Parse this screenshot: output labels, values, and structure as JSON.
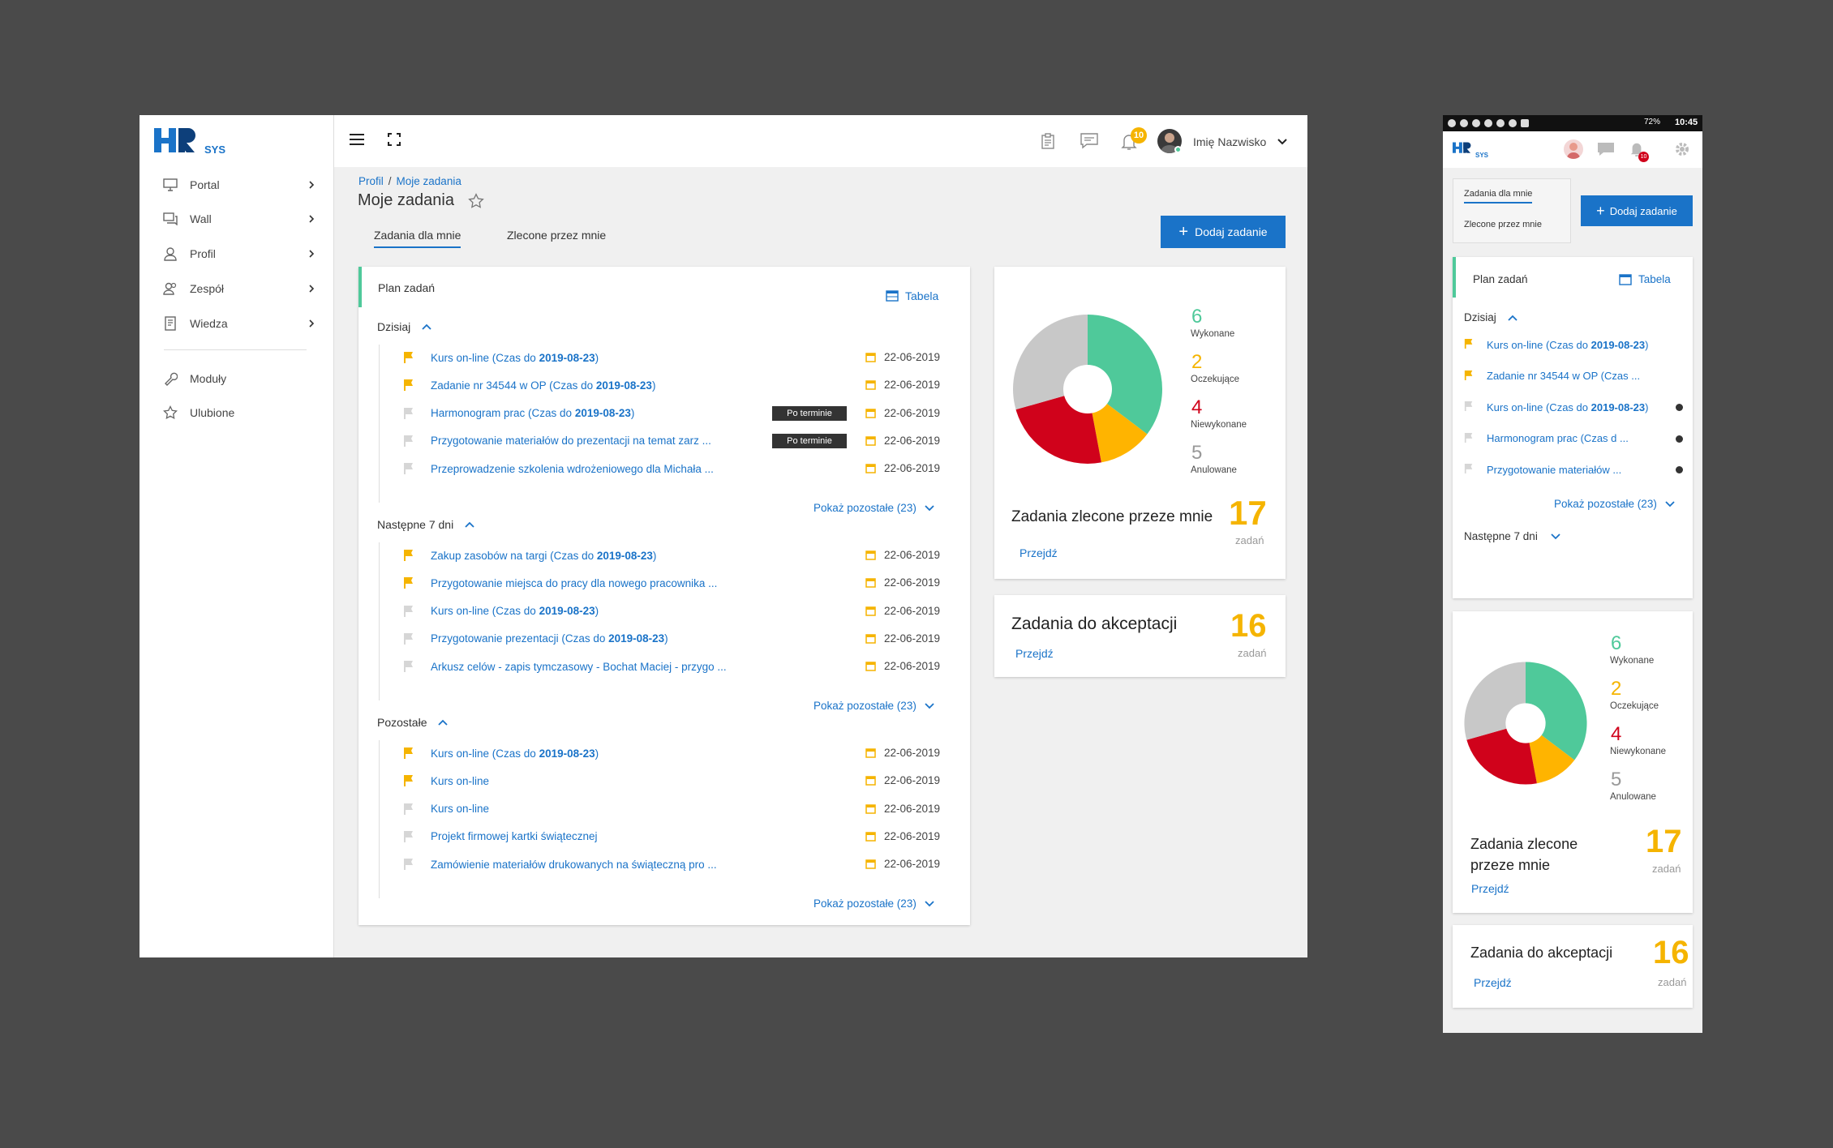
{
  "brand": {
    "logo": "HR",
    "logo_sub": "SYS"
  },
  "sidebar": {
    "items": [
      {
        "label": "Portal",
        "icon": "monitor-icon"
      },
      {
        "label": "Wall",
        "icon": "chat-icon"
      },
      {
        "label": "Profil",
        "icon": "user-icon"
      },
      {
        "label": "Zespół",
        "icon": "team-icon"
      },
      {
        "label": "Wiedza",
        "icon": "book-icon"
      }
    ],
    "extra": [
      {
        "label": "Moduły",
        "icon": "wrench-icon"
      },
      {
        "label": "Ulubione",
        "icon": "star-icon"
      }
    ]
  },
  "topbar": {
    "notif_count": "10",
    "user_name": "Imię Nazwisko"
  },
  "breadcrumb": [
    "Profil",
    "Moje zadania"
  ],
  "page_title": "Moje zadania",
  "tabs": [
    "Zadania dla mnie",
    "Zlecone przez mnie"
  ],
  "add_button": "Dodaj zadanie",
  "plan": {
    "title": "Plan zadań",
    "table_link": "Tabela",
    "sections": [
      {
        "label": "Dzisiaj",
        "tasks": [
          {
            "pre": "Kurs on-line (Czas do ",
            "bold": "2019-08-23",
            "post": ")",
            "flag": "yellow",
            "date": "22-06-2019",
            "badge": ""
          },
          {
            "pre": "Zadanie nr 34544 w OP (Czas do ",
            "bold": "2019-08-23",
            "post": ")",
            "flag": "yellow",
            "date": "22-06-2019",
            "badge": ""
          },
          {
            "pre": "Harmonogram prac (Czas do ",
            "bold": "2019-08-23",
            "post": ")",
            "flag": "gray",
            "date": "22-06-2019",
            "badge": "Po terminie"
          },
          {
            "pre": "Przygotowanie materiałów do prezentacji na temat zarz   ...",
            "bold": "",
            "post": "",
            "flag": "gray",
            "date": "22-06-2019",
            "badge": "Po terminie"
          },
          {
            "pre": "Przeprowadzenie szkolenia wdrożeniowego dla Michała   ...",
            "bold": "",
            "post": "",
            "flag": "gray",
            "date": "22-06-2019",
            "badge": ""
          }
        ],
        "more": "Pokaż pozostałe (23)"
      },
      {
        "label": "Następne 7 dni",
        "tasks": [
          {
            "pre": "Zakup zasobów na targi (Czas do ",
            "bold": "2019-08-23",
            "post": ")",
            "flag": "yellow",
            "date": "22-06-2019",
            "badge": ""
          },
          {
            "pre": "Przygotowanie miejsca do pracy dla nowego pracownika ...",
            "bold": "",
            "post": "",
            "flag": "yellow",
            "date": "22-06-2019",
            "badge": ""
          },
          {
            "pre": "Kurs on-line (Czas do ",
            "bold": "2019-08-23",
            "post": ")",
            "flag": "gray",
            "date": "22-06-2019",
            "badge": ""
          },
          {
            "pre": "Przygotowanie prezentacji (Czas do ",
            "bold": "2019-08-23",
            "post": ")",
            "flag": "gray",
            "date": "22-06-2019",
            "badge": ""
          },
          {
            "pre": "Arkusz celów - zapis tymczasowy - Bochat Maciej - przygo ...",
            "bold": "",
            "post": "",
            "flag": "gray",
            "date": "22-06-2019",
            "badge": ""
          }
        ],
        "more": "Pokaż pozostałe (23)"
      },
      {
        "label": "Pozostałe",
        "tasks": [
          {
            "pre": "Kurs on-line (Czas do ",
            "bold": "2019-08-23",
            "post": ")",
            "flag": "yellow",
            "date": "22-06-2019",
            "badge": ""
          },
          {
            "pre": "Kurs on-line",
            "bold": "",
            "post": "",
            "flag": "yellow",
            "date": "22-06-2019",
            "badge": ""
          },
          {
            "pre": "Kurs on-line",
            "bold": "",
            "post": "",
            "flag": "gray",
            "date": "22-06-2019",
            "badge": ""
          },
          {
            "pre": "Projekt firmowej kartki świątecznej",
            "bold": "",
            "post": "",
            "flag": "gray",
            "date": "22-06-2019",
            "badge": ""
          },
          {
            "pre": "Zamówienie materiałów drukowanych na świąteczną pro ...",
            "bold": "",
            "post": "",
            "flag": "gray",
            "date": "22-06-2019",
            "badge": ""
          }
        ],
        "more": "Pokaż pozostałe (23)"
      }
    ]
  },
  "stats": {
    "items": [
      {
        "value": 6,
        "label": "Wykonane",
        "color": "#4fc99a"
      },
      {
        "value": 2,
        "label": "Oczekujące",
        "color": "#f5b400"
      },
      {
        "value": 4,
        "label": "Niewykonane",
        "color": "#d0021b"
      },
      {
        "value": 5,
        "label": "Anulowane",
        "color": "#999999"
      }
    ],
    "pie_colors": [
      "#4fc99a",
      "#ffb400",
      "#d0021b",
      "#c8c8c8"
    ],
    "title": "Zadania zlecone przeze mnie",
    "total": "17",
    "unit": "zadań",
    "link": "Przejdź"
  },
  "accept": {
    "title": "Zadania do akceptacji",
    "total": "16",
    "unit": "zadań",
    "link": "Przejdź"
  },
  "mobile": {
    "status_time": "10:45",
    "status_battery": "72%",
    "notif_count": "10",
    "tabs": [
      "Zadania dla mnie",
      "Zlecone przez mnie"
    ],
    "add_button": "Dodaj zadanie",
    "plan_title": "Plan zadań",
    "table_link": "Tabela",
    "today": "Dzisiaj",
    "tasks": [
      {
        "pre": "Kurs on-line (Czas do ",
        "bold": "2019-08-23",
        "post": ")",
        "flag": "yellow",
        "dot": false
      },
      {
        "pre": "Zadanie nr 34544 w OP (Czas     ...",
        "bold": "",
        "post": "",
        "flag": "yellow",
        "dot": false
      },
      {
        "pre": "Kurs on-line (Czas do ",
        "bold": "2019-08-23",
        "post": ")",
        "flag": "gray",
        "dot": true
      },
      {
        "pre": "Harmonogram prac (Czas d     ...",
        "bold": "",
        "post": "",
        "flag": "gray",
        "dot": true
      },
      {
        "pre": "Przygotowanie materiałów     ...",
        "bold": "",
        "post": "",
        "flag": "gray",
        "dot": true
      }
    ],
    "more": "Pokaż pozostałe (23)",
    "next": "Następne 7 dni",
    "stats_title_l1": "Zadania zlecone",
    "stats_title_l2": "przeze mnie",
    "total": "17",
    "unit": "zadań",
    "link": "Przejdź",
    "accept_title": "Zadania do akceptacji",
    "accept_total": "16",
    "accept_unit": "zadań",
    "accept_link": "Przejdź"
  }
}
